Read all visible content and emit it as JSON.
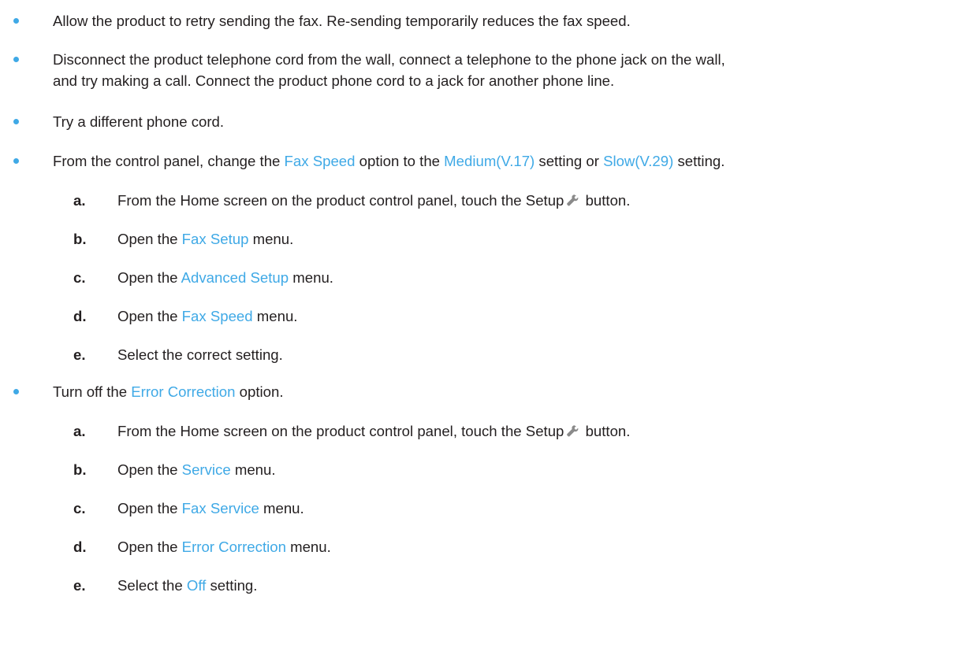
{
  "bullets": [
    {
      "text": "Allow the product to retry sending the fax. Re-sending temporarily reduces the fax speed."
    },
    {
      "line1": "Disconnect the product telephone cord from the wall, connect a telephone to the phone jack on the wall,",
      "line2": "and try making a call. Connect the product phone cord to a jack for another phone line."
    },
    {
      "text": "Try a different phone cord."
    },
    {
      "p1": "From the control panel, change the ",
      "k1": "Fax Speed",
      "p2": " option to the ",
      "k2": "Medium(V.17)",
      "p3": " setting or ",
      "k3": "Slow(V.29)",
      "p4": " setting.",
      "steps": [
        {
          "letter": "a.",
          "p1": "From the Home screen on the product control panel, touch the Setup",
          "icon": "wrench-icon",
          "p2": " button."
        },
        {
          "letter": "b.",
          "p1": "Open the ",
          "k": "Fax Setup",
          "p2": " menu."
        },
        {
          "letter": "c.",
          "p1": "Open the ",
          "k": "Advanced Setup",
          "p2": " menu."
        },
        {
          "letter": "d.",
          "p1": "Open the ",
          "k": "Fax Speed",
          "p2": " menu."
        },
        {
          "letter": "e.",
          "p1": "Select the correct setting."
        }
      ]
    },
    {
      "p1": "Turn off the ",
      "k1": "Error Correction",
      "p2": " option.",
      "steps": [
        {
          "letter": "a.",
          "p1": "From the Home screen on the product control panel, touch the Setup",
          "icon": "wrench-icon",
          "p2": " button."
        },
        {
          "letter": "b.",
          "p1": "Open the ",
          "k": "Service",
          "p2": " menu."
        },
        {
          "letter": "c.",
          "p1": "Open the ",
          "k": "Fax Service",
          "p2": " menu."
        },
        {
          "letter": "d.",
          "p1": "Open the ",
          "k": "Error Correction",
          "p2": " menu."
        },
        {
          "letter": "e.",
          "p1": "Select the ",
          "k": "Off",
          "p2": " setting."
        }
      ]
    }
  ],
  "colors": {
    "accent": "#3fa9e6",
    "text": "#231f20",
    "icon": "#8a8a8a"
  }
}
